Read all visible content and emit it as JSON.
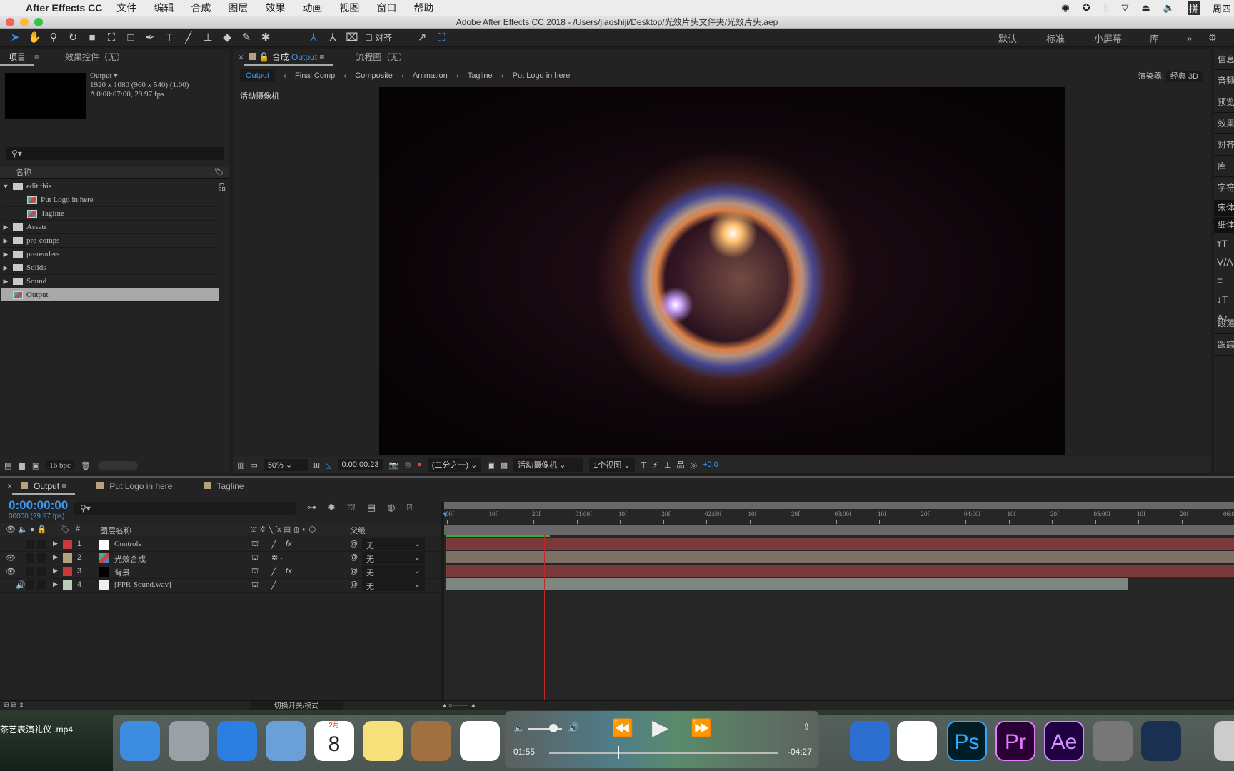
{
  "menubar": {
    "app": "After Effects CC",
    "items": [
      "文件",
      "编辑",
      "合成",
      "图层",
      "效果",
      "动画",
      "视图",
      "窗口",
      "帮助"
    ],
    "clock": "周四"
  },
  "window": {
    "title": "Adobe After Effects CC 2018 - /Users/jiaoshiji/Desktop/光效片头文件夹/光效片头.aep"
  },
  "toolbar": {
    "snap_label": "对齐",
    "workspaces": [
      "默认",
      "标准",
      "小屏幕",
      "库"
    ]
  },
  "project": {
    "tabs": [
      "项目",
      "效果控件（无）"
    ],
    "preview": {
      "name": "Output ▾",
      "size": "1920 x 1080  (960 x 540) (1.00)",
      "duration": "Δ 0:00:07:00, 29.97 fps"
    },
    "column_name": "名称",
    "items": [
      {
        "name": "edit this",
        "type": "folder",
        "expanded": true,
        "indent": 0
      },
      {
        "name": "Put Logo in here",
        "type": "comp",
        "indent": 1
      },
      {
        "name": "Tagline",
        "type": "comp",
        "indent": 1
      },
      {
        "name": "Assets",
        "type": "folder",
        "indent": 0
      },
      {
        "name": "pre-comps",
        "type": "folder",
        "indent": 0
      },
      {
        "name": "prerenders",
        "type": "folder",
        "indent": 0
      },
      {
        "name": "Solids",
        "type": "folder",
        "indent": 0
      },
      {
        "name": "Sound",
        "type": "folder",
        "indent": 0
      },
      {
        "name": "Output",
        "type": "comp",
        "indent": 0,
        "selected": true
      }
    ],
    "bpc": "16 bpc"
  },
  "comp": {
    "tab_prefix": "合成",
    "tab_name": "Output",
    "flow_tab": "流程图（无）",
    "breadcrumbs": [
      "Output",
      "Final Comp",
      "Composite",
      "Animation",
      "Tagline",
      "Put Logo in here"
    ],
    "renderer_label": "渲染器:",
    "renderer": "经典 3D",
    "camera_label": "活动摄像机",
    "viewer_bar": {
      "zoom": "50%",
      "time": "0:00:00:23",
      "resolution": "(二分之一)",
      "camera": "活动摄像机",
      "views": "1个视图",
      "exposure": "+0.0"
    }
  },
  "right_panel": {
    "items": [
      "信息",
      "音频",
      "预览",
      "效果",
      "对齐",
      "库",
      "字符",
      "宋体",
      "细体",
      "段落",
      "跟踪"
    ]
  },
  "timeline": {
    "tabs": [
      "Output",
      "Put Logo in here",
      "Tagline"
    ],
    "timecode": "0:00:00:00",
    "fps": "00000 (29.97 fps)",
    "col_name": "图层名称",
    "col_parent": "父级",
    "ruler": [
      "00f",
      "10f",
      "20f",
      "01:00f",
      "10f",
      "20f",
      "02:00f",
      "10f",
      "20f",
      "03:00f",
      "10f",
      "20f",
      "04:00f",
      "10f",
      "20f",
      "05:00f",
      "10f",
      "20f",
      "06:00f"
    ],
    "layers": [
      {
        "num": "1",
        "name": "Controls",
        "label_color": "#c8393b",
        "thumb": "#ffffff",
        "parent": "无",
        "bar_color": "#7a3a3c",
        "eye": false,
        "fx": true
      },
      {
        "num": "2",
        "name": "光效合成",
        "label_color": "#b5a17e",
        "thumb": "comp",
        "parent": "无",
        "bar_color": "#7d7164",
        "eye": true,
        "fx": false
      },
      {
        "num": "3",
        "name": "背景",
        "label_color": "#c8393b",
        "thumb": "#000000",
        "parent": "无",
        "bar_color": "#7a3a3c",
        "eye": true,
        "fx": true
      },
      {
        "num": "4",
        "name": "[FPR-Sound.wav]",
        "label_color": "#b8ccb8",
        "thumb": "audio",
        "parent": "无",
        "bar_color": "#7c8781",
        "eye": false,
        "audio": true,
        "fx": false
      }
    ],
    "toggle_label": "切换开关/模式"
  },
  "media_player": {
    "title": "茶艺表演礼仪 .mp4",
    "elapsed": "01:55",
    "remaining": "-04:27",
    "progress": 0.3,
    "volume": 0.75
  },
  "dock": {
    "apps": [
      "Finder",
      "Launchpad",
      "Safari",
      "Mail",
      "Calendar",
      "Notes",
      "Contacts",
      "Reminders",
      "Keynote",
      "iTunes",
      "Ps",
      "Pr",
      "Ae",
      "System Preferences",
      "QuickTime",
      "Trash"
    ],
    "calendar_month": "2月",
    "calendar_day": "8"
  }
}
